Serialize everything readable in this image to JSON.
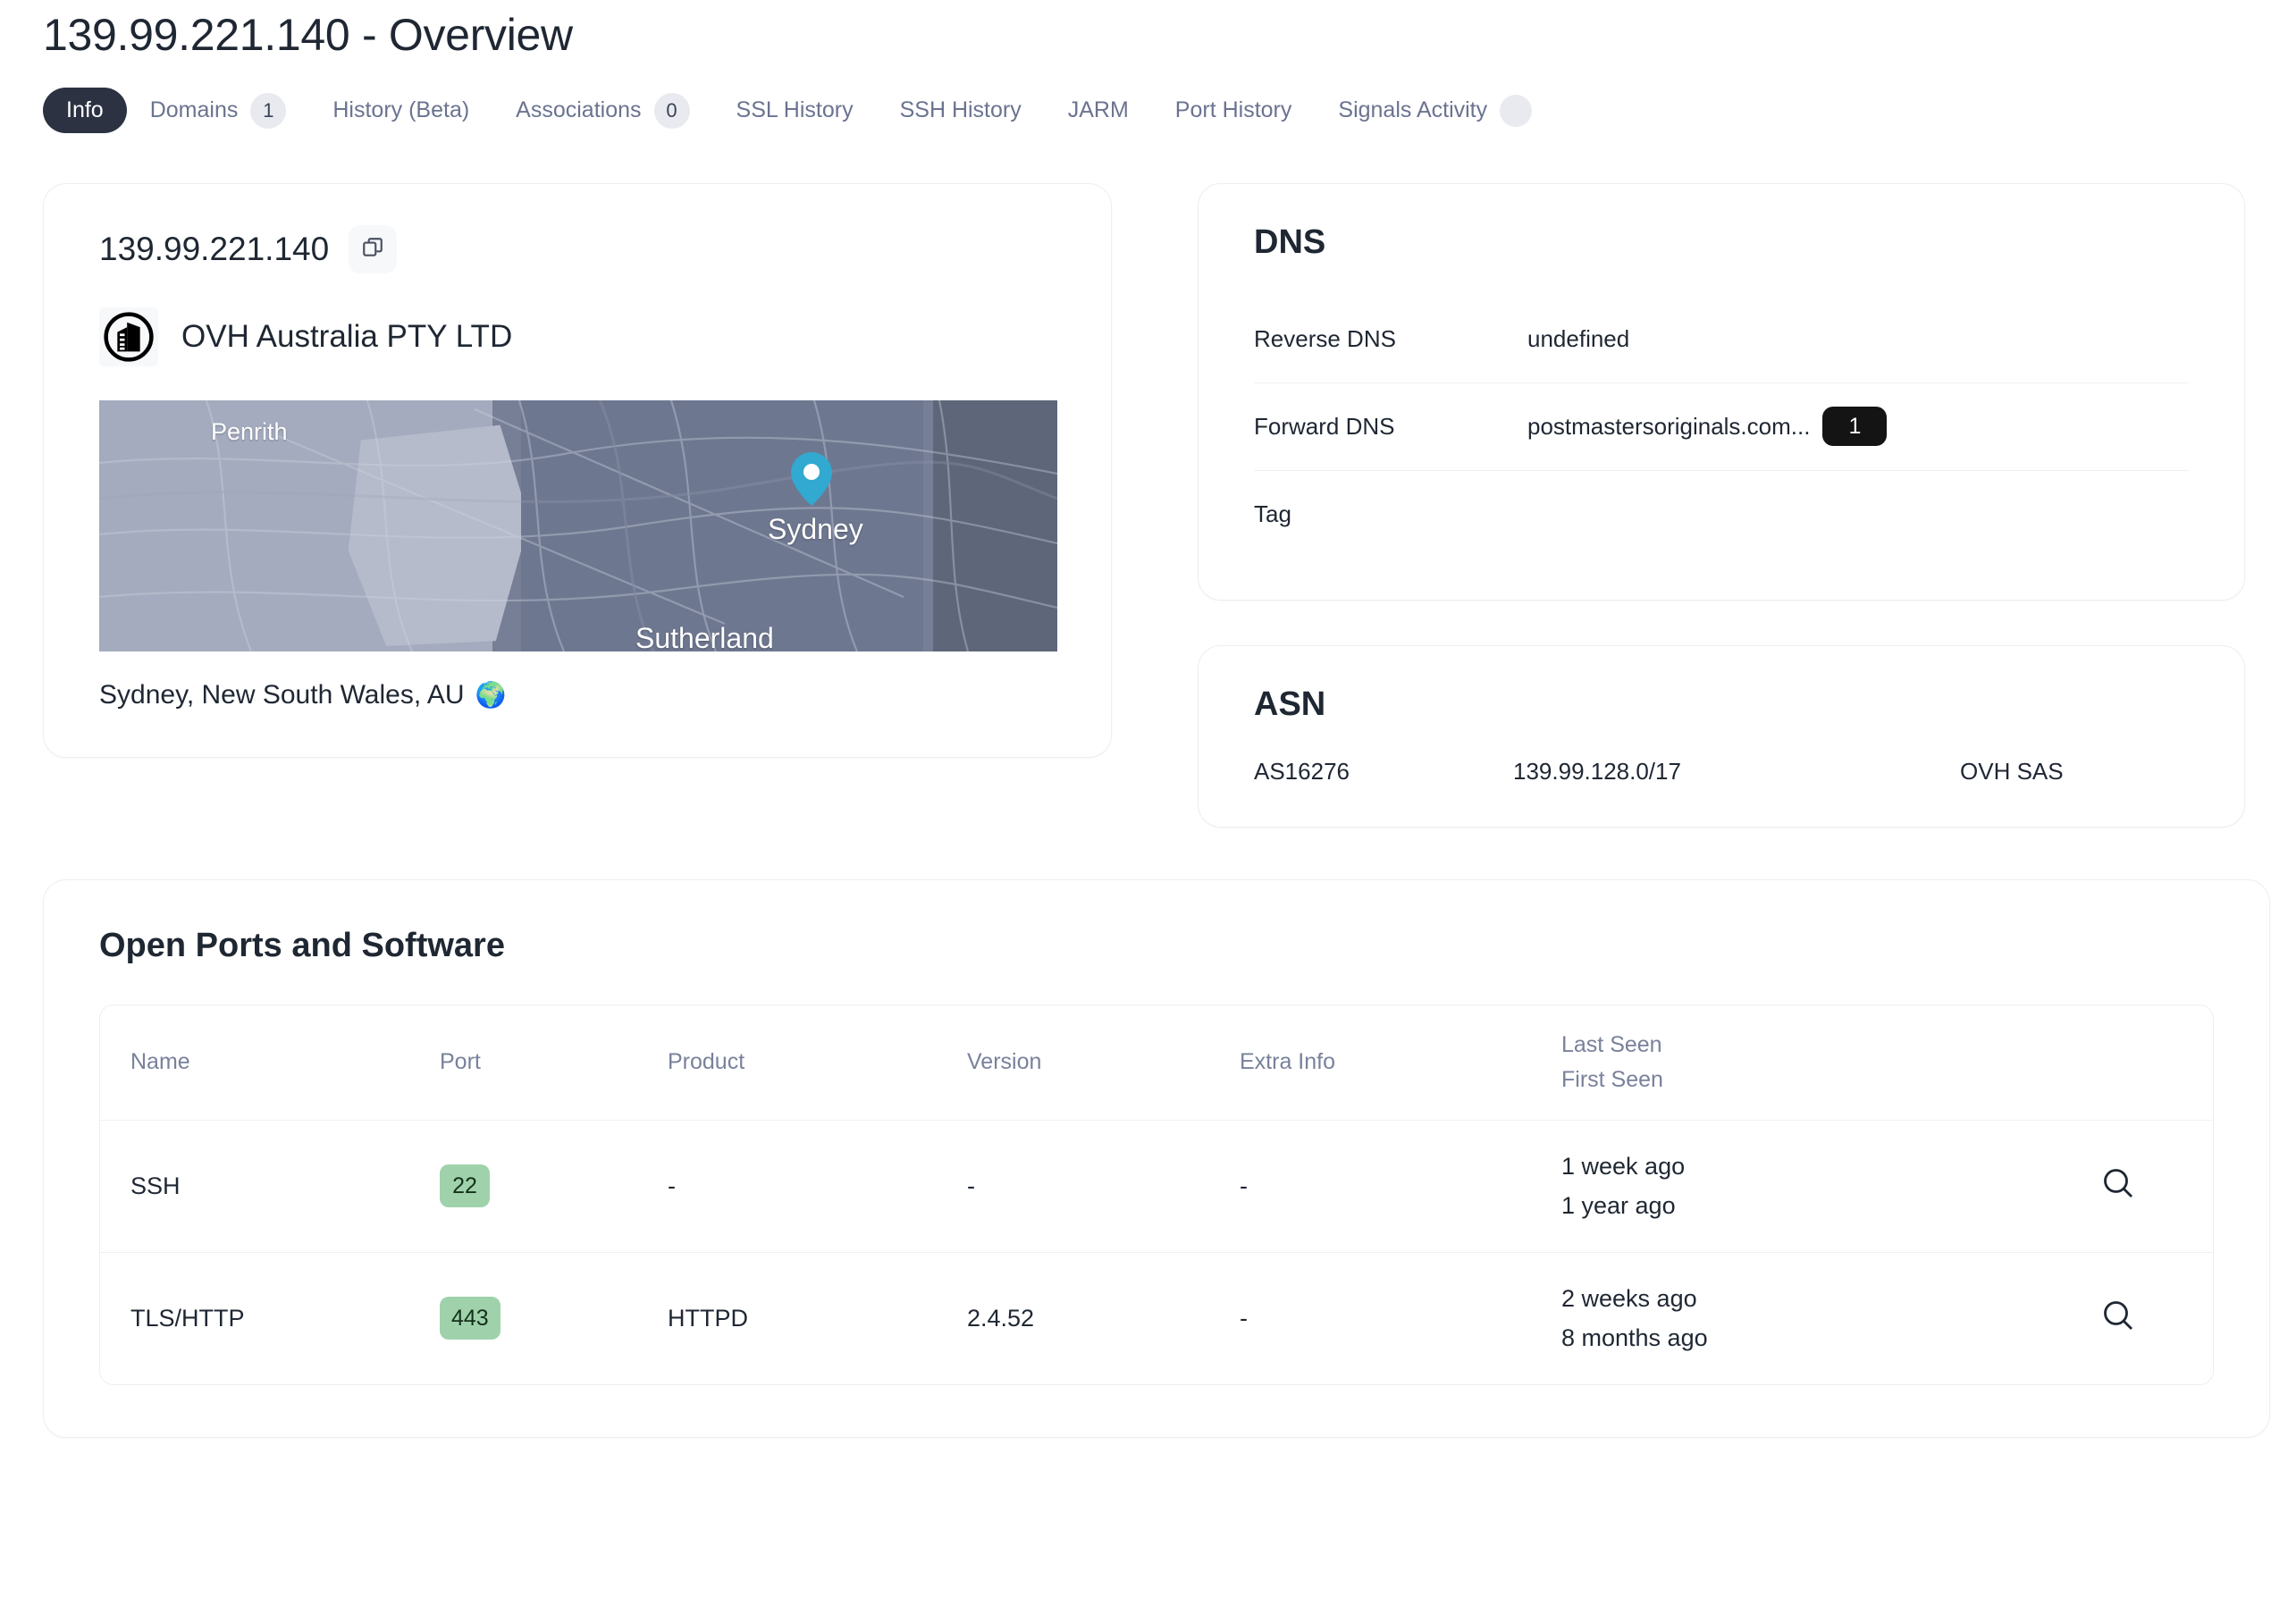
{
  "header": {
    "title": "139.99.221.140 - Overview",
    "tabs": [
      {
        "label": "Info",
        "badge": null,
        "active": true,
        "name": "tab-info"
      },
      {
        "label": "Domains",
        "badge": "1",
        "active": false,
        "name": "tab-domains"
      },
      {
        "label": "History (Beta)",
        "badge": null,
        "active": false,
        "name": "tab-history"
      },
      {
        "label": "Associations",
        "badge": "0",
        "active": false,
        "name": "tab-associations"
      },
      {
        "label": "SSL History",
        "badge": null,
        "active": false,
        "name": "tab-ssl-history"
      },
      {
        "label": "SSH History",
        "badge": null,
        "active": false,
        "name": "tab-ssh-history"
      },
      {
        "label": "JARM",
        "badge": null,
        "active": false,
        "name": "tab-jarm"
      },
      {
        "label": "Port History",
        "badge": null,
        "active": false,
        "name": "tab-port-history"
      },
      {
        "label": "Signals Activity",
        "badge": "",
        "active": false,
        "name": "tab-signals-activity"
      }
    ]
  },
  "ip_card": {
    "ip": "139.99.221.140",
    "copy_icon": "copy-icon",
    "org_icon": "building-icon",
    "org_name": "OVH Australia PTY LTD",
    "map": {
      "labels": [
        "Penrith",
        "Sydney",
        "Sutherland"
      ],
      "pin_color": "#31a9d0",
      "pin_label": "Sydney"
    },
    "location": "Sydney, New South Wales, AU",
    "location_icon": "globe-icon"
  },
  "dns_card": {
    "heading": "DNS",
    "rows": [
      {
        "label": "Reverse DNS",
        "value": "undefined",
        "badge": null
      },
      {
        "label": "Forward DNS",
        "value": "postmastersoriginals.com...",
        "badge": "1"
      },
      {
        "label": "Tag",
        "value": "",
        "badge": null
      }
    ]
  },
  "asn_card": {
    "heading": "ASN",
    "asn": "AS16276",
    "prefix": "139.99.128.0/17",
    "org": "OVH SAS"
  },
  "ports_card": {
    "title": "Open Ports and Software",
    "columns": {
      "name": "Name",
      "port": "Port",
      "product": "Product",
      "version": "Version",
      "extra_info": "Extra Info",
      "last_seen": "Last Seen",
      "first_seen": "First Seen"
    },
    "rows": [
      {
        "name": "SSH",
        "port": "22",
        "product": "-",
        "version": "-",
        "extra_info": "-",
        "last_seen": "1 week ago",
        "first_seen": "1 year ago",
        "action_icon": "search-icon"
      },
      {
        "name": "TLS/HTTP",
        "port": "443",
        "product": "HTTPD",
        "version": "2.4.52",
        "extra_info": "-",
        "last_seen": "2 weeks ago",
        "first_seen": "8 months ago",
        "action_icon": "search-icon"
      }
    ]
  },
  "colors": {
    "active_tab_bg": "#2c3242",
    "tab_text": "#6b7390",
    "badge_bg": "#e8eaef",
    "port_badge_bg": "#9fd2ab",
    "dark_badge_bg": "#141414",
    "card_border": "#eceef2",
    "map_pin": "#31a9d0"
  }
}
